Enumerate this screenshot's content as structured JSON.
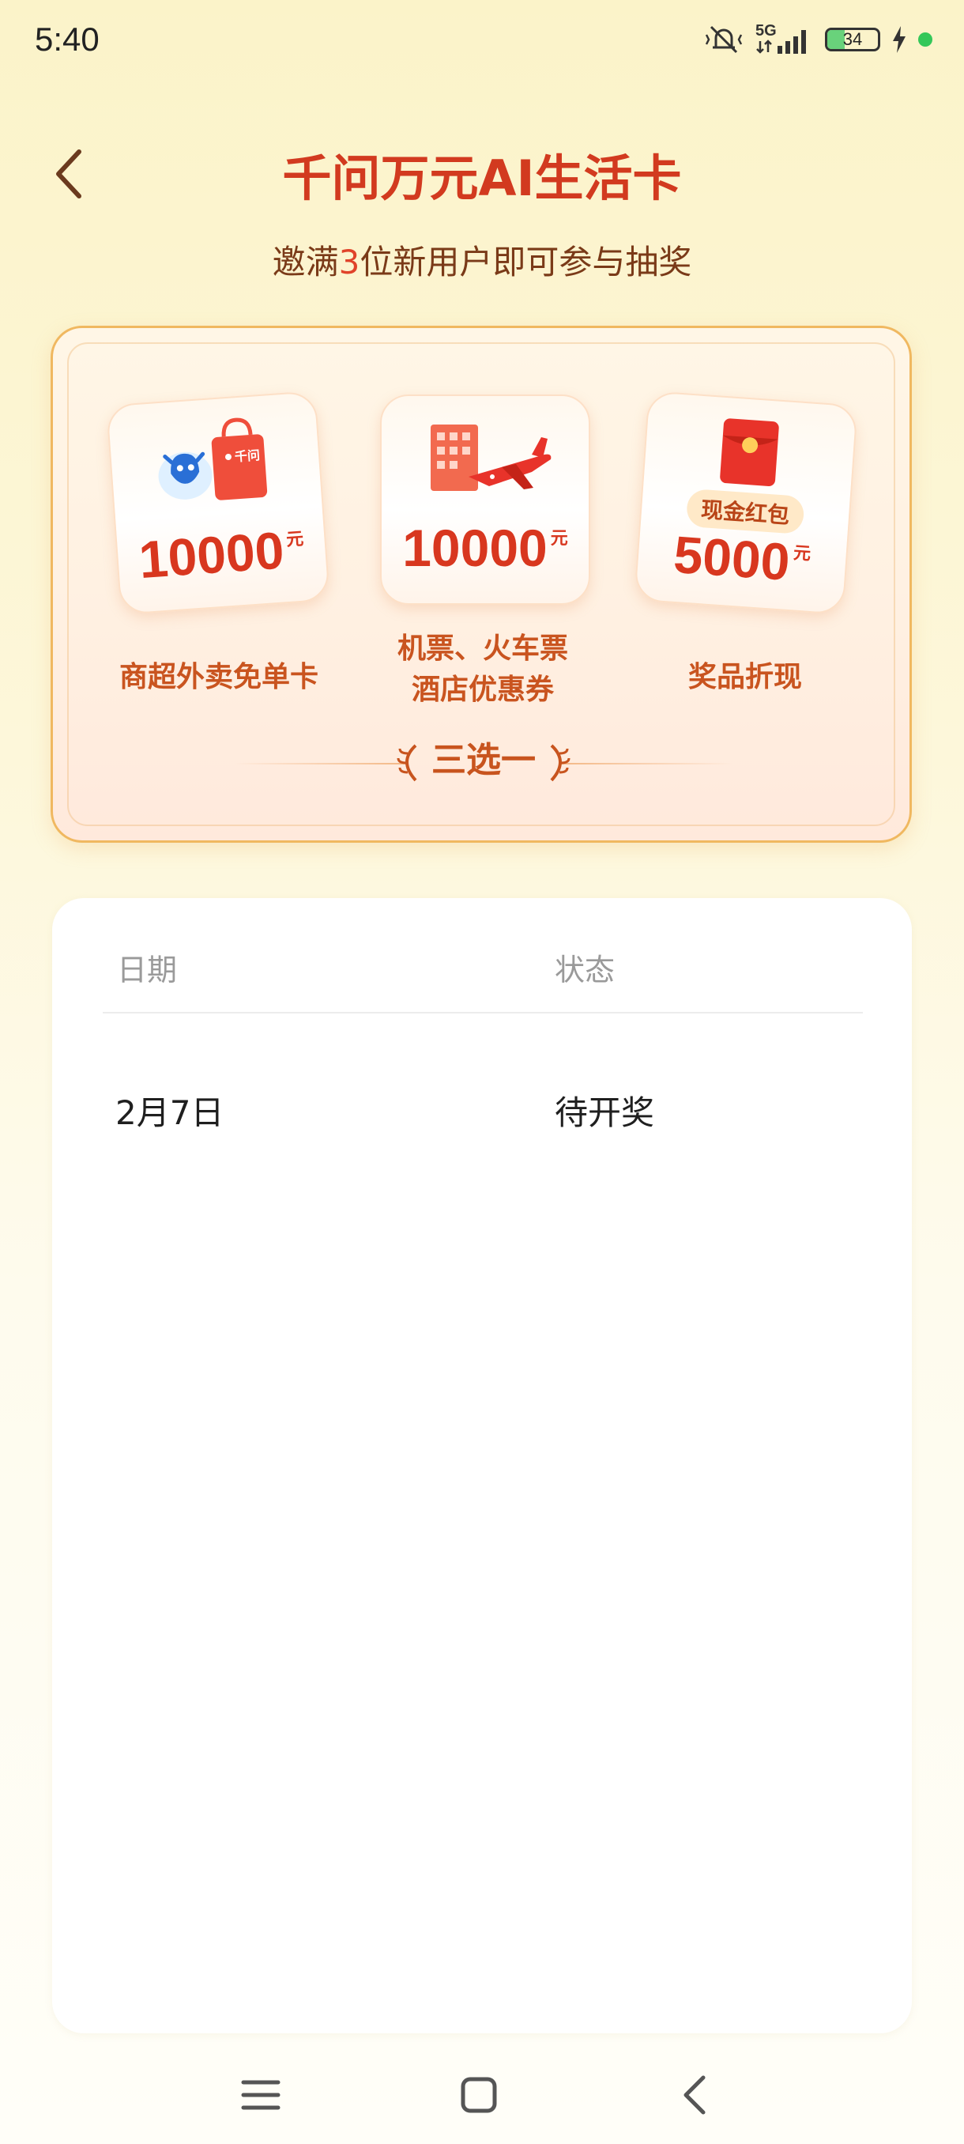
{
  "status_bar": {
    "time": "5:40",
    "network": "5G",
    "battery": "34",
    "battery_level": 0.34
  },
  "header": {
    "title": "千问万元AI生活卡",
    "subtitle_prefix": "邀满",
    "subtitle_number": "3",
    "subtitle_suffix": "位新用户即可参与抽奖"
  },
  "prizes": [
    {
      "amount": "10000",
      "unit": "元",
      "label_line1": "商超外卖免单卡",
      "label_line2": "",
      "icon": "shopping-bag-icon",
      "bag_text": "千问"
    },
    {
      "amount": "10000",
      "unit": "元",
      "label_line1": "机票、火车票",
      "label_line2": "酒店优惠券",
      "icon": "airplane-hotel-icon"
    },
    {
      "amount": "5000",
      "unit": "元",
      "label_line1": "奖品折现",
      "label_line2": "",
      "icon": "red-envelope-icon",
      "tag": "现金红包"
    }
  ],
  "choose_text": "三选一",
  "table": {
    "headers": {
      "date": "日期",
      "status": "状态"
    },
    "rows": [
      {
        "date": "2月7日",
        "status": "待开奖"
      }
    ]
  },
  "colors": {
    "accent": "#d23a1f",
    "label": "#c9541f",
    "background": "#fbf3c9"
  }
}
